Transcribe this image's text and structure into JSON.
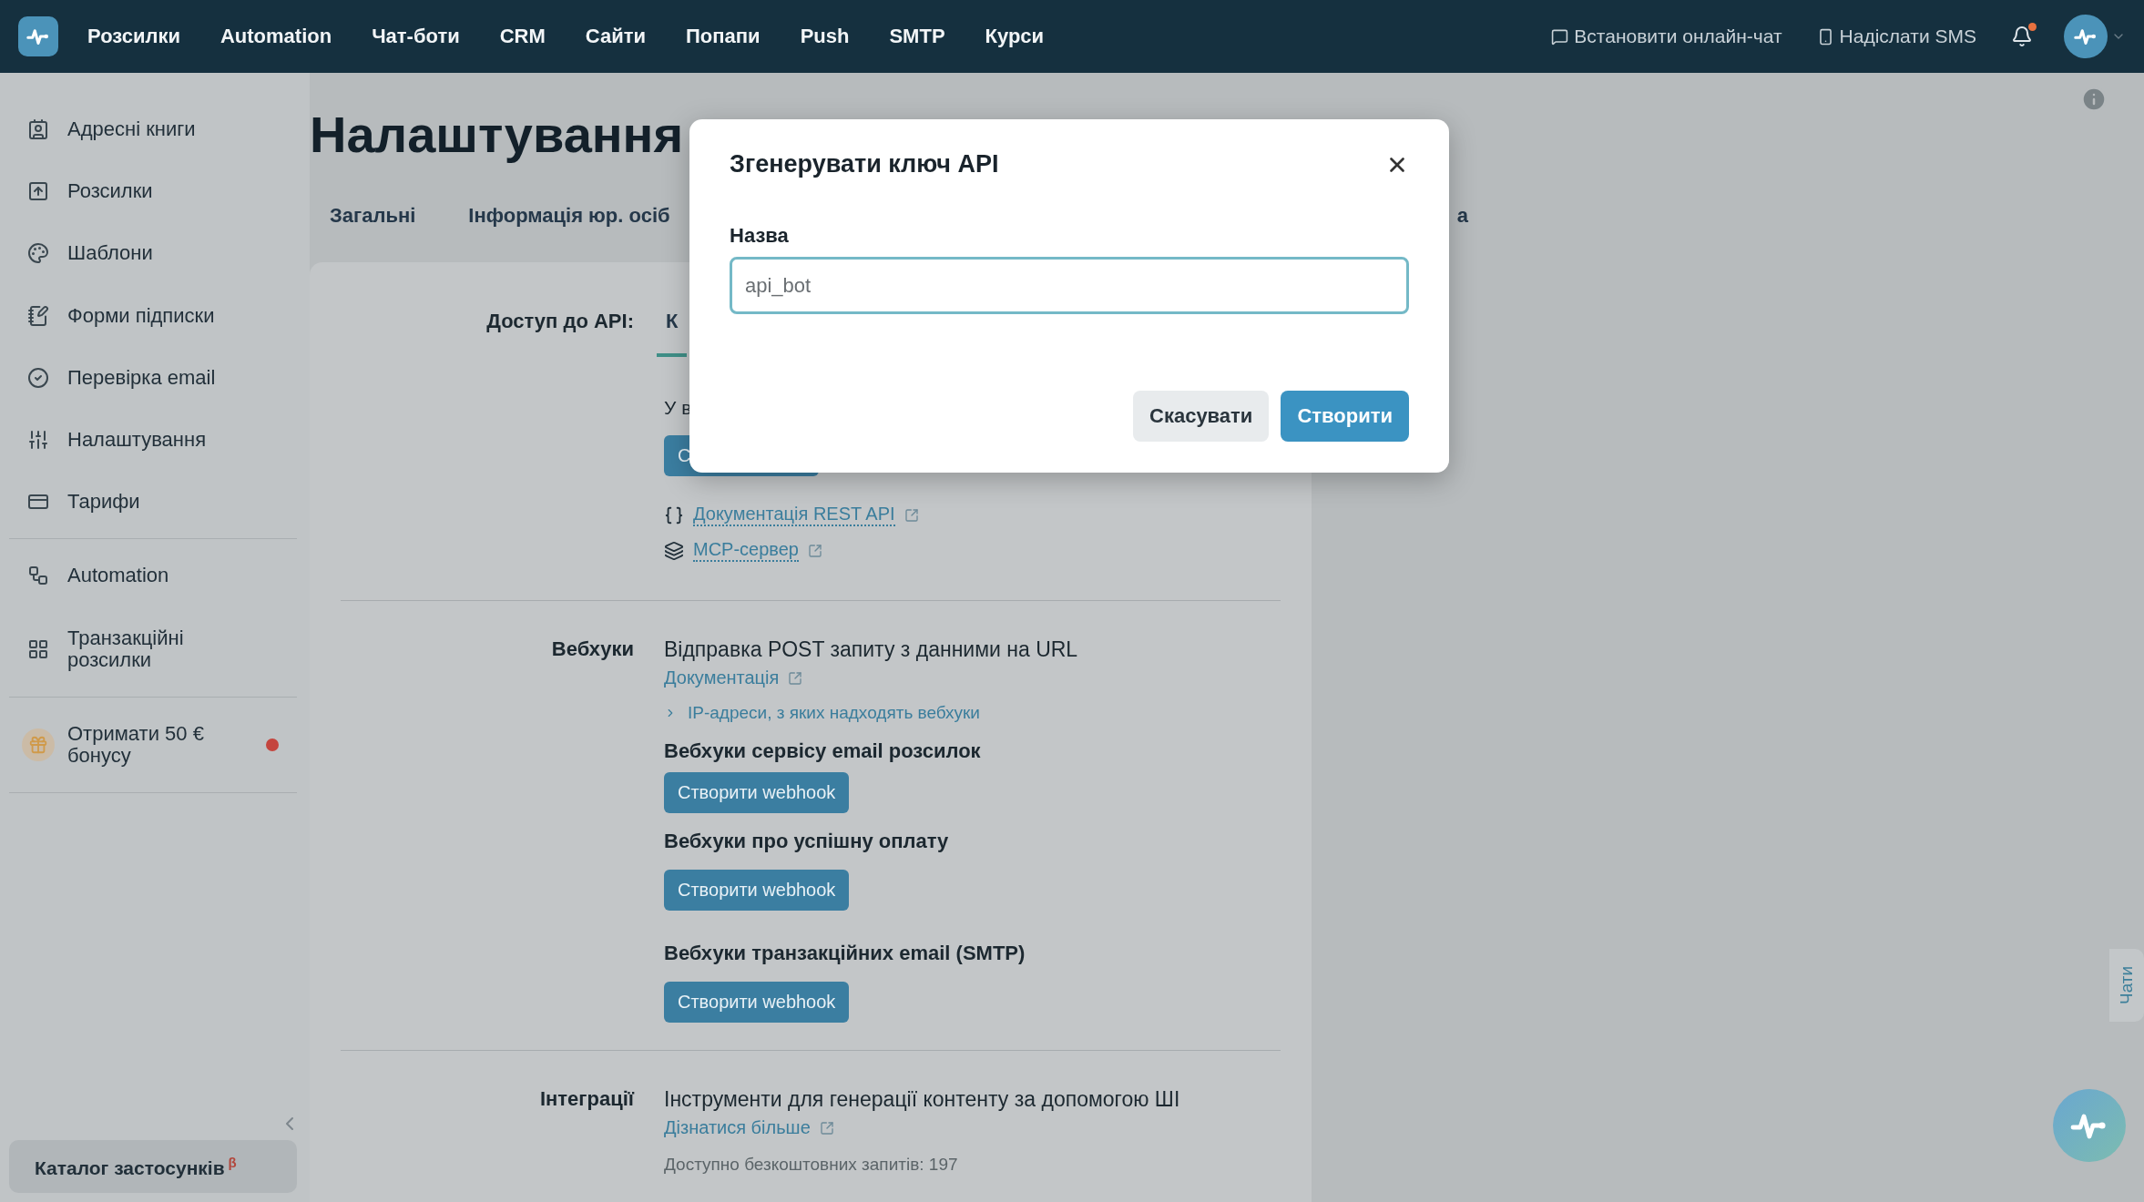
{
  "top_bar": {
    "nav": [
      "Розсилки",
      "Automation",
      "Чат-боти",
      "CRM",
      "Сайти",
      "Попапи",
      "Push",
      "SMTP",
      "Курси"
    ],
    "actions": [
      {
        "kind": "chat",
        "label": "Встановити онлайн-чат"
      },
      {
        "kind": "sms",
        "label": "Надіслати SMS"
      }
    ],
    "notifications": {
      "unread": true
    }
  },
  "sidebar": {
    "groups": [
      [
        {
          "label": "Адресні книги",
          "attention": false
        },
        {
          "label": "Розсилки",
          "attention": false
        },
        {
          "label": "Шаблони",
          "attention": false
        },
        {
          "label": "Форми підписки",
          "attention": false
        },
        {
          "label": "Перевірка email",
          "attention": false
        },
        {
          "label": "Налаштування",
          "attention": false
        },
        {
          "label": "Тарифи",
          "attention": false
        }
      ],
      [
        {
          "label": "Automation",
          "attention": false
        },
        {
          "label": "Транзакційні розсилки",
          "attention": false
        }
      ],
      [
        {
          "label": "Отримати 50 € бонусу",
          "attention": true
        }
      ]
    ],
    "catalog": {
      "label": "Каталог застосунків",
      "badge": "β"
    }
  },
  "page": {
    "title": "Налаштування",
    "tabs": [
      {
        "label": "Загальні",
        "selected": false
      },
      {
        "label": "Інформація юр. осіб",
        "selected": false
      },
      {
        "label": "а",
        "selected": false
      }
    ],
    "api_access": {
      "label": "Доступ до API:",
      "tabs": [
        {
          "label": "К",
          "selected": true
        }
      ],
      "text": "У в",
      "button": "С",
      "links": [
        {
          "kind": "code",
          "label": "Документація REST API"
        },
        {
          "kind": "mcp",
          "label": "МСР-сервер"
        }
      ]
    },
    "webhooks": {
      "label": "Вебхуки",
      "description": "Відправка POST запиту з данними на URL",
      "doc_link": "Документація",
      "ip_toggle": {
        "label": "IP-адреси, з яких надходять вебхуки",
        "expanded": false
      },
      "groups": [
        {
          "title": "Вебхуки сервісу email розсилок",
          "button": "Створити webhook"
        },
        {
          "title": "Вебхуки про успішну оплату",
          "button": "Створити webhook"
        },
        {
          "title": "Вебхуки транзакційних email (SMTP)",
          "button": "Створити webhook"
        }
      ]
    },
    "integrations": {
      "label": "Інтеграції",
      "description": "Інструменти для генерації контенту за допомогою ШІ",
      "link": "Дізнатися більше",
      "quota": "Доступно безкоштовних запитів: 197"
    }
  },
  "side_tab": {
    "label": "Чати"
  },
  "modal": {
    "title": "Згенерувати ключ API",
    "field": {
      "label": "Назва",
      "value": "api_bot"
    },
    "buttons": [
      {
        "kind": "secondary",
        "label": "Скасувати"
      },
      {
        "kind": "primary",
        "label": "Створити"
      }
    ]
  }
}
